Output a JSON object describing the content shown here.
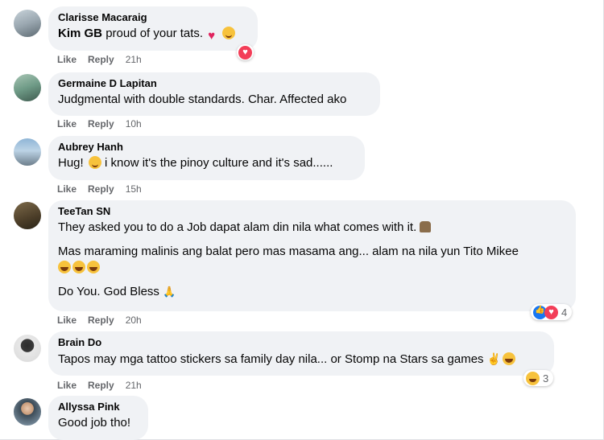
{
  "comments": [
    {
      "author": "Clarisse Macaraig",
      "mention": "Kim GB",
      "text": "proud of your tats.",
      "emojis": [
        "heart",
        "kiss"
      ],
      "actions": {
        "like": "Like",
        "reply": "Reply",
        "time": "21h"
      },
      "reactions": {
        "icons": [
          "love"
        ],
        "count": ""
      }
    },
    {
      "author": "Germaine D Lapitan",
      "text": "Judgmental with double standards. Char. Affected ako",
      "actions": {
        "like": "Like",
        "reply": "Reply",
        "time": "10h"
      }
    },
    {
      "author": "Aubrey Hanh",
      "text_before": "Hug!",
      "text_after": "i know it's the pinoy culture and it's sad......",
      "emojis": [
        "smile"
      ],
      "actions": {
        "like": "Like",
        "reply": "Reply",
        "time": "15h"
      }
    },
    {
      "author": "TeeTan SN",
      "paragraphs": [
        "They asked you to do a Job dapat alam din nila what comes with it.",
        "Mas maraming malinis ang balat pero mas masama ang... alam na nila yun Tito Mikee",
        "Do You. God Bless"
      ],
      "emojis": [
        "person",
        "laugh",
        "laugh",
        "laugh",
        "pray"
      ],
      "actions": {
        "like": "Like",
        "reply": "Reply",
        "time": "20h"
      },
      "reactions": {
        "icons": [
          "like",
          "love"
        ],
        "count": "4"
      }
    },
    {
      "author": "Brain Do",
      "text": "Tapos may mga tattoo stickers sa family day nila... or Stomp na Stars sa games",
      "emojis": [
        "peace",
        "laugh"
      ],
      "actions": {
        "like": "Like",
        "reply": "Reply",
        "time": "21h"
      },
      "reactions": {
        "icons": [
          "haha"
        ],
        "count": "3"
      }
    },
    {
      "author": "Allyssa Pink",
      "text": "Good job tho!"
    }
  ],
  "colors": {
    "bubble": "#f0f2f5",
    "meta": "#65676b",
    "like_blue": "#1877f2",
    "love_red": "#f33e58"
  }
}
